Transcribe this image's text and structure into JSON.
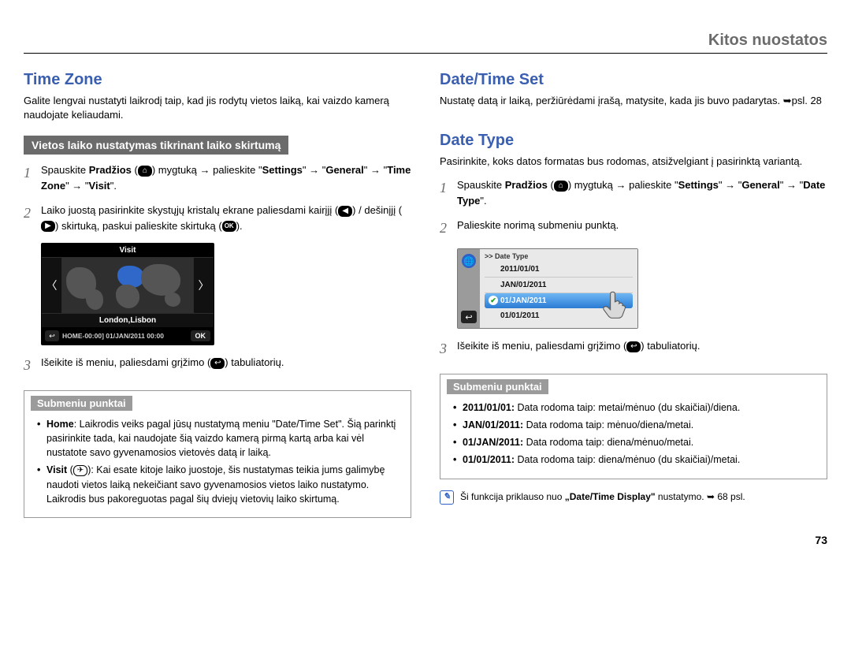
{
  "header": {
    "title": "Kitos nuostatos"
  },
  "pageNumber": "73",
  "left": {
    "h": "Time Zone",
    "intro": "Galite lengvai nustatyti laikrodį taip, kad jis rodytų vietos laiką, kai vaizdo kamerą naudojate keliaudami.",
    "subhead": "Vietos laiko nustatymas tikrinant laiko skirtumą",
    "s1_a": "Spauskite ",
    "s1_b": "Pradžios",
    "s1_c": " (",
    "s1_d": ") mygtuką ",
    "s1_e": " palieskite \"",
    "s1_f": "Settings",
    "s1_g": "\" ",
    "s1_h": " \"",
    "s1_i": "General",
    "s1_j": "\" ",
    "s1_k": " \"",
    "s1_l": "Time Zone",
    "s1_m": "\" ",
    "s1_n": " \"",
    "s1_o": "Visit",
    "s1_p": "\".",
    "s2_a": "Laiko juostą pasirinkite skystųjų kristalų ekrane paliesdami kairįjį (",
    "s2_b": ") / dešinįjį (",
    "s2_c": ") skirtuką, paskui palieskite skirtuką (",
    "s2_d": ").",
    "s3_a": "Išeikite iš meniu, paliesdami grįžimo (",
    "s3_b": ") tabuliatorių.",
    "lcd": {
      "title": "Visit",
      "city": "London,Lisbon",
      "status": "HOME-00:00] 01/JAN/2011 00:00",
      "ok": "OK"
    },
    "submenuLabel": "Submeniu punktai",
    "sm1_a": "Home",
    "sm1_b": ": Laikrodis veiks pagal jūsų nustatymą meniu \"Date/Time Set\". Šią parinktį pasirinkite tada, kai naudojate šią vaizdo kamerą pirmą kartą arba kai vėl nustatote savo gyvenamosios vietovės datą ir laiką.",
    "sm2_a": "Visit",
    "sm2_b": " (",
    "sm2_c": "): Kai esate kitoje laiko juostoje, šis nustatymas teikia jums galimybę naudoti vietos laiką nekeičiant savo gyvenamosios vietos laiko nustatymo. Laikrodis bus pakoreguotas pagal šių dviejų vietovių laiko skirtumą."
  },
  "right": {
    "dts_h": "Date/Time Set",
    "dts_intro_a": "Nustatę datą ir laiką, peržiūrėdami įrašą, matysite, kada jis buvo padarytas. ",
    "dts_intro_b": "psl. 28",
    "dt_h": "Date Type",
    "dt_intro": "Pasirinkite, koks datos formatas bus rodomas, atsižvelgiant į pasirinktą variantą.",
    "s1_a": "Spauskite ",
    "s1_b": "Pradžios",
    "s1_c": " (",
    "s1_d": ") mygtuką ",
    "s1_e": " palieskite \"",
    "s1_f": "Settings",
    "s1_g": "\" ",
    "s1_h": " \"",
    "s1_i": "General",
    "s1_j": "\" ",
    "s1_k": " \"",
    "s1_l": "Date Type",
    "s1_m": "\".",
    "s2": "Palieskite norimą submeniu punktą.",
    "s3_a": "Išeikite iš meniu, paliesdami grįžimo (",
    "s3_b": ") tabuliatorių.",
    "lcd": {
      "crumb": ">> Date Type",
      "o1": "2011/01/01",
      "o2": "JAN/01/2011",
      "o3": "01/JAN/2011",
      "o4": "01/01/2011"
    },
    "submenuLabel": "Submeniu punktai",
    "sm1_a": "2011/01/01:",
    "sm1_b": " Data rodoma taip: metai/mėnuo (du skaičiai)/diena.",
    "sm2_a": "JAN/01/2011:",
    "sm2_b": " Data rodoma taip: mėnuo/diena/metai.",
    "sm3_a": "01/JAN/2011:",
    "sm3_b": " Data rodoma taip: diena/mėnuo/metai.",
    "sm4_a": "01/01/2011:",
    "sm4_b": " Data rodoma taip: diena/mėnuo (du skaičiai)/metai.",
    "note_a": "Ši funkcija priklauso nuo ",
    "note_b": "„Date/Time Display\"",
    "note_c": " nustatymo. ",
    "note_d": " 68 psl."
  }
}
